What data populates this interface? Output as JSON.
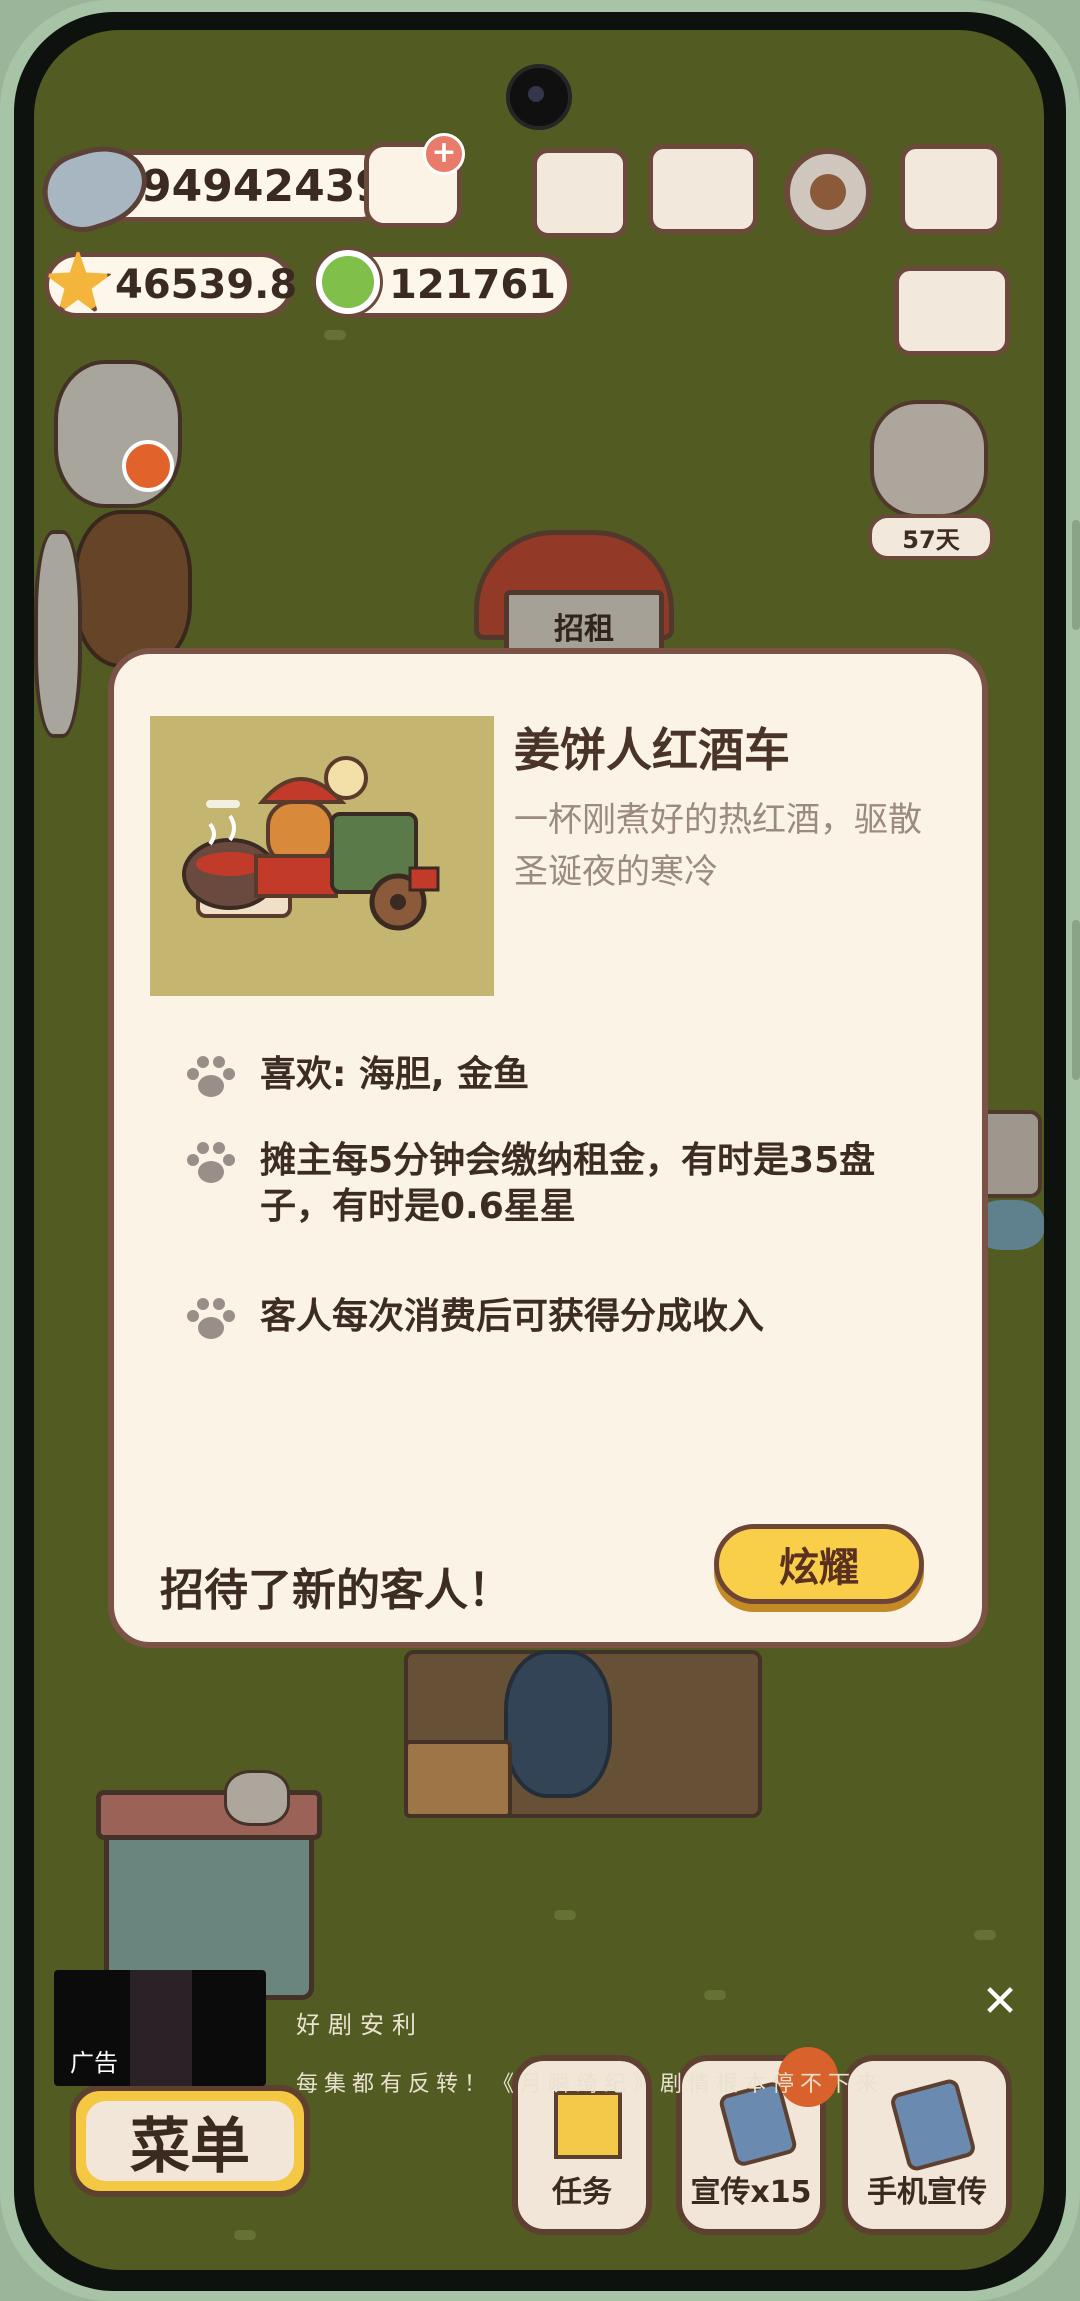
{
  "hud": {
    "fish_count": "94942439",
    "star_count": "46539.8",
    "ring_count": "121761",
    "icons": [
      "fish-icon",
      "shopping-cart-plus-icon",
      "star-icon",
      "donut-icon",
      "newspaper-icon",
      "book-icon",
      "gear-icon",
      "map-icon",
      "sort-icon"
    ]
  },
  "scene": {
    "rent_sign": "招租",
    "days_badge": "57天"
  },
  "modal": {
    "title": "姜饼人红酒车",
    "description": "一杯刚煮好的热红酒，驱散圣诞夜的寒冷",
    "features": [
      "喜欢: 海胆, 金鱼",
      "摊主每5分钟会缴纳租金，有时是35盘子，有时是0.6星星",
      "客人每次消费后可获得分成收入"
    ],
    "footer": "招待了新的客人！",
    "show_button": "炫耀"
  },
  "ad": {
    "label": "广告",
    "title": "好剧安利",
    "subtitle": "每集都有反转！《月瞬绮纪》剧情根本停不下来",
    "close": "✕"
  },
  "bottom_bar": {
    "menu_label": "菜单",
    "task_label": "任务",
    "promo_label": "宣传x15",
    "phone_promo_label": "手机宣传"
  },
  "colors": {
    "modal_bg": "#fbf3e6",
    "modal_border": "#7a5346",
    "button_yellow": "#f9cf49",
    "ground": "#6d7a2c"
  }
}
